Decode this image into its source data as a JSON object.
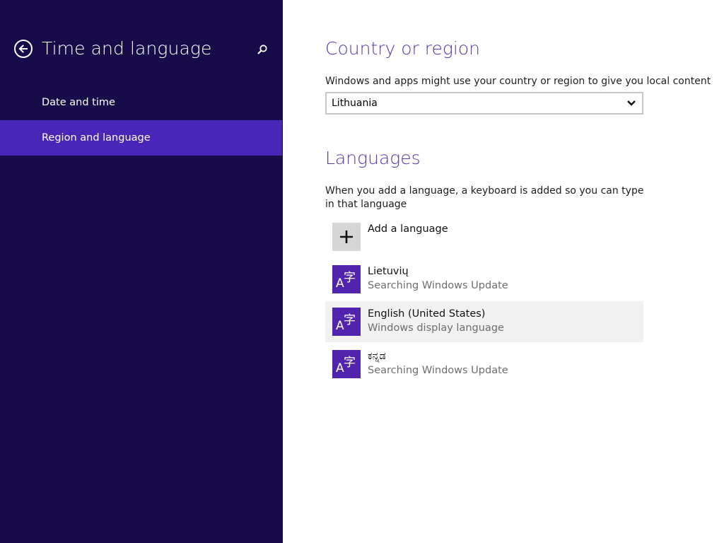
{
  "sidebar": {
    "title": "Time and language",
    "items": [
      {
        "label": "Date and time"
      },
      {
        "label": "Region and language"
      }
    ]
  },
  "country": {
    "title": "Country or region",
    "description": "Windows and apps might use your country or region to give you local content",
    "selected": "Lithuania"
  },
  "languages": {
    "title": "Languages",
    "description": "When you add a language, a keyboard is added so you can type in that language",
    "add_label": "Add a language",
    "items": [
      {
        "name": "Lietuvių",
        "status": "Searching Windows Update",
        "icon_text": "A字"
      },
      {
        "name": "English (United States)",
        "status": "Windows display language",
        "icon_text": "A字"
      },
      {
        "name": "ಕನ್ನಡ",
        "status": "Searching Windows Update",
        "icon_text": "A字"
      }
    ]
  },
  "colors": {
    "sidebar_bg": "#180b4a",
    "accent": "#4a26b8",
    "title_color": "#4f3cab",
    "tile_color": "#5224ad"
  },
  "icons": [
    "back-arrow-icon",
    "search-icon",
    "chevron-down-icon",
    "plus-icon",
    "language-icon"
  ]
}
